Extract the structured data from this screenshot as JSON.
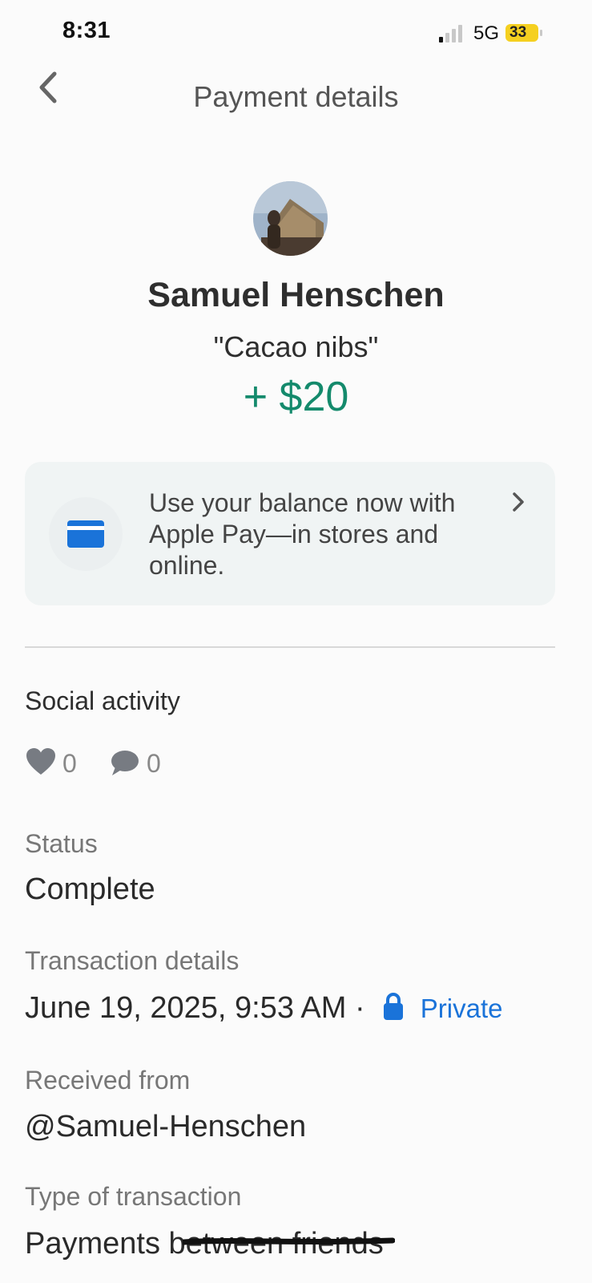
{
  "status_bar": {
    "time": "8:31",
    "network": "5G",
    "battery": "33"
  },
  "header": {
    "title": "Payment details",
    "back_icon": "chevron-left-icon"
  },
  "payment": {
    "name": "Samuel Henschen",
    "note": "\"Cacao nibs\"",
    "amount": "+ $20",
    "amount_color": "#148a6c"
  },
  "promo": {
    "text": "Use your balance now with Apple Pay—in stores and online.",
    "icon": "credit-card-icon",
    "icon_color": "#1a73d9"
  },
  "social": {
    "label": "Social activity",
    "likes": "0",
    "comments": "0"
  },
  "details": {
    "status_label": "Status",
    "status_value": "Complete",
    "transaction_label": "Transaction details",
    "transaction_date": "June 19, 2025, 9:53 AM",
    "separator": "·",
    "privacy": "Private",
    "received_label": "Received from",
    "received_value": "@Samuel-Henschen",
    "type_label": "Type of transaction",
    "type_value": "Payments between friends"
  }
}
